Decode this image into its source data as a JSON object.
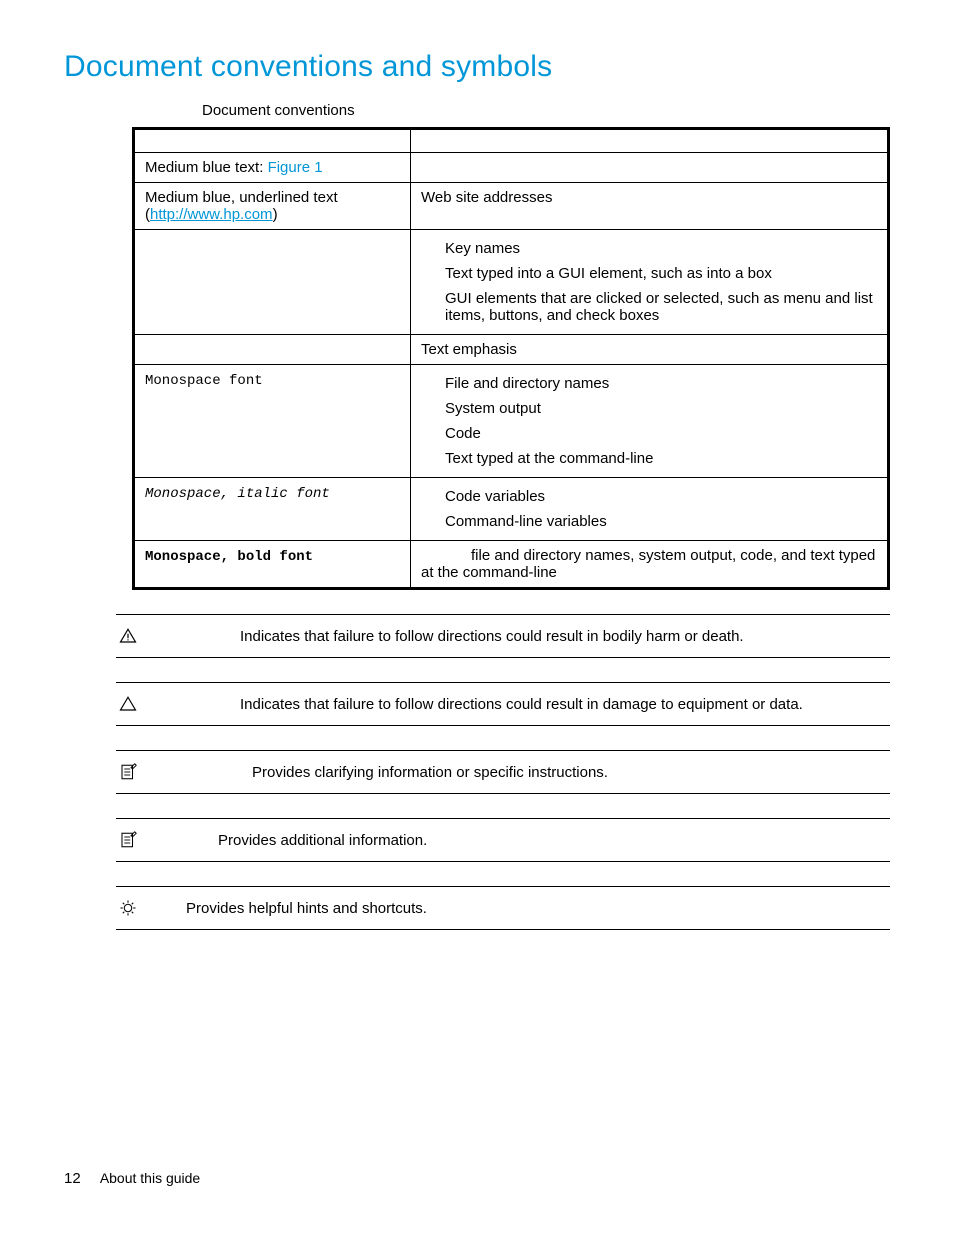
{
  "title": "Document conventions and symbols",
  "caption": "Document conventions",
  "table": {
    "rows": [
      {
        "left_pre": "Medium blue text: ",
        "left_link": "Figure 1",
        "left_style": "blue",
        "right": ""
      },
      {
        "left_pre": "Medium blue, underlined text (",
        "left_link": "http://www.hp.com",
        "left_post": ")",
        "left_style": "blue-underline",
        "right": "Web site addresses"
      },
      {
        "left": "",
        "right_list": [
          "Key names",
          "Text typed into a GUI element, such as into a box",
          "GUI elements that are clicked or selected, such as menu and list items, buttons, and check boxes"
        ]
      },
      {
        "left": "",
        "right": "Text emphasis"
      },
      {
        "left": "Monospace font",
        "left_style": "mono",
        "right_list": [
          "File and directory names",
          "System output",
          "Code",
          "Text typed at the command-line"
        ]
      },
      {
        "left": "Monospace, italic font",
        "left_style": "mono-italic",
        "right_list": [
          "Code variables",
          "Command-line variables"
        ]
      },
      {
        "left": "Monospace, bold font",
        "left_style": "mono-bold",
        "right_indent": "file and directory names, system output, code, and text typed at the command-line"
      }
    ]
  },
  "notices": [
    {
      "icon": "warning",
      "text": "Indicates that failure to follow directions could result in bodily harm or death.",
      "pad": 80
    },
    {
      "icon": "caution",
      "text": "Indicates that failure to follow directions could result in damage to equipment or data.",
      "pad": 80
    },
    {
      "icon": "important",
      "text": "Provides clarifying information or specific instructions.",
      "pad": 92
    },
    {
      "icon": "note",
      "text": "Provides additional information.",
      "pad": 58
    },
    {
      "icon": "tip",
      "text": "Provides helpful hints and shortcuts.",
      "pad": 26
    }
  ],
  "footer": {
    "page": "12",
    "section": "About this guide"
  }
}
